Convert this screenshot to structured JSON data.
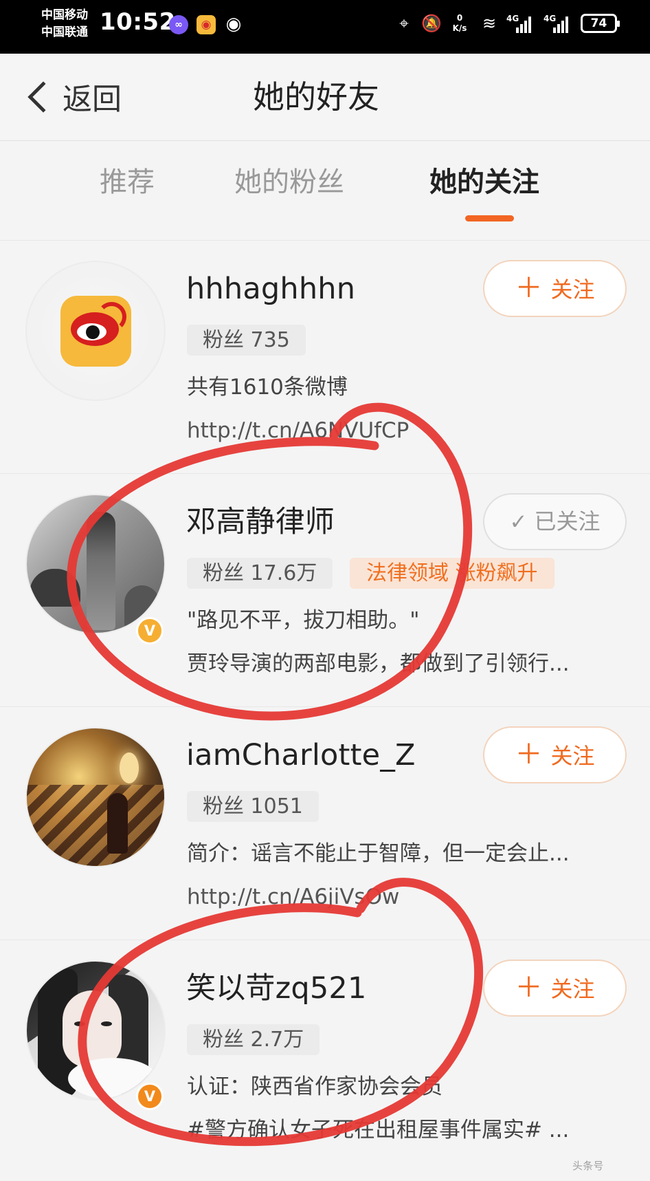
{
  "status_bar": {
    "carrier_1": "中国移动",
    "carrier_2": "中国联通",
    "time": "10:52",
    "speed_top": "0",
    "speed_bottom": "K/s",
    "network_1": "4G",
    "network_2": "4G",
    "battery": "74",
    "icons": [
      "purple-app-icon",
      "weibo-icon",
      "eye-icon",
      "location-icon",
      "mute-bell-icon",
      "wifi-icon",
      "signal-icon",
      "battery-icon"
    ]
  },
  "nav": {
    "back_label": "返回",
    "title": "她的好友"
  },
  "tabs": [
    {
      "label": "推荐",
      "active": false
    },
    {
      "label": "她的粉丝",
      "active": false
    },
    {
      "label": "她的关注",
      "active": true
    }
  ],
  "users": [
    {
      "name": "hhhaghhhn",
      "fans": "粉丝 735",
      "desc_1": "共有1610条微博",
      "desc_2": "http://t.cn/A6NVUfCP",
      "button": "关注",
      "button_icon": "plus-icon",
      "verified": false,
      "avatar": "weibo-logo-avatar"
    },
    {
      "name": "邓高静律师",
      "fans": "粉丝 17.6万",
      "tag": "法律领域 涨粉飙升",
      "desc_1": "\"路见不平，拔刀相助。\"",
      "desc_2": "贾玲导演的两部电影，都做到了引领行...",
      "button": "已关注",
      "button_icon": "check-icon",
      "verified": true,
      "avatar": "monochrome-person-avatar"
    },
    {
      "name": "iamCharlotte_Z",
      "fans": "粉丝 1051",
      "desc_1": "简介：谣言不能止于智障，但一定会止...",
      "desc_2": "http://t.cn/A6jiVsOw",
      "button": "关注",
      "button_icon": "plus-icon",
      "verified": false,
      "avatar": "staircase-person-avatar"
    },
    {
      "name": "笑以苛zq521",
      "fans": "粉丝 2.7万",
      "desc_1": "认证：陕西省作家协会会员",
      "desc_2": "#警方确认女子死在出租屋事件属实# ...",
      "button": "关注",
      "button_icon": "plus-icon",
      "verified": true,
      "avatar": "portrait-avatar"
    }
  ],
  "annotations": {
    "circle_color": "#e53935"
  },
  "watermark": "头条号"
}
